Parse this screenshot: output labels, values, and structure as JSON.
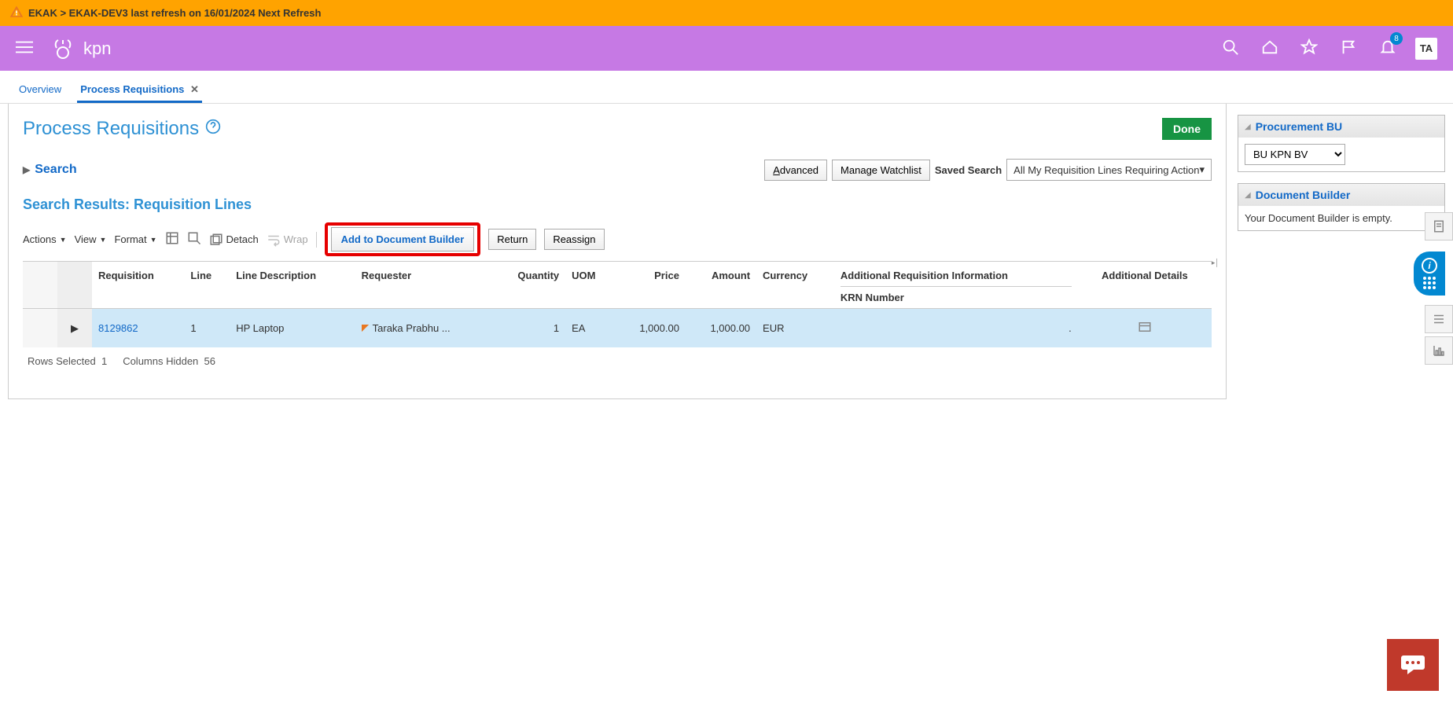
{
  "env_bar": "EKAK > EKAK-DEV3 last refresh on 16/01/2024 Next Refresh",
  "header": {
    "brand": "kpn",
    "notification_count": "8",
    "avatar": "TA"
  },
  "tabs": [
    {
      "label": "Overview",
      "active": false,
      "closable": false
    },
    {
      "label": "Process Requisitions",
      "active": true,
      "closable": true
    }
  ],
  "page": {
    "title": "Process Requisitions",
    "done": "Done",
    "search_toggle": "Search",
    "advanced": "Advanced",
    "advanced_key": "A",
    "manage_watchlist": "Manage Watchlist",
    "saved_search_label": "Saved Search",
    "saved_search_value": "All My Requisition Lines Requiring Action",
    "section_title": "Search Results: Requisition Lines",
    "toolbar": {
      "actions": "Actions",
      "view": "View",
      "format": "Format",
      "detach": "Detach",
      "wrap": "Wrap",
      "add_doc_builder": "Add to Document Builder",
      "return": "Return",
      "reassign": "Reassign"
    },
    "columns": {
      "requisition": "Requisition",
      "line": "Line",
      "line_description": "Line Description",
      "requester": "Requester",
      "quantity": "Quantity",
      "uom": "UOM",
      "price": "Price",
      "amount": "Amount",
      "currency": "Currency",
      "addl_req_info": "Additional Requisition Information",
      "krn_number": "KRN Number",
      "addl_details": "Additional Details"
    },
    "rows": [
      {
        "requisition": "8129862",
        "line": "1",
        "line_description": "HP Laptop",
        "requester": "Taraka Prabhu ...",
        "quantity": "1",
        "uom": "EA",
        "price": "1,000.00",
        "amount": "1,000.00",
        "currency": "EUR",
        "krn_number": "."
      }
    ],
    "footer": {
      "rows_selected_label": "Rows Selected",
      "rows_selected_value": "1",
      "columns_hidden_label": "Columns Hidden",
      "columns_hidden_value": "56"
    }
  },
  "right_rail": {
    "procurement_bu": {
      "title": "Procurement BU",
      "value": "BU KPN BV"
    },
    "doc_builder": {
      "title": "Document Builder",
      "empty_text": "Your Document Builder is empty."
    }
  }
}
